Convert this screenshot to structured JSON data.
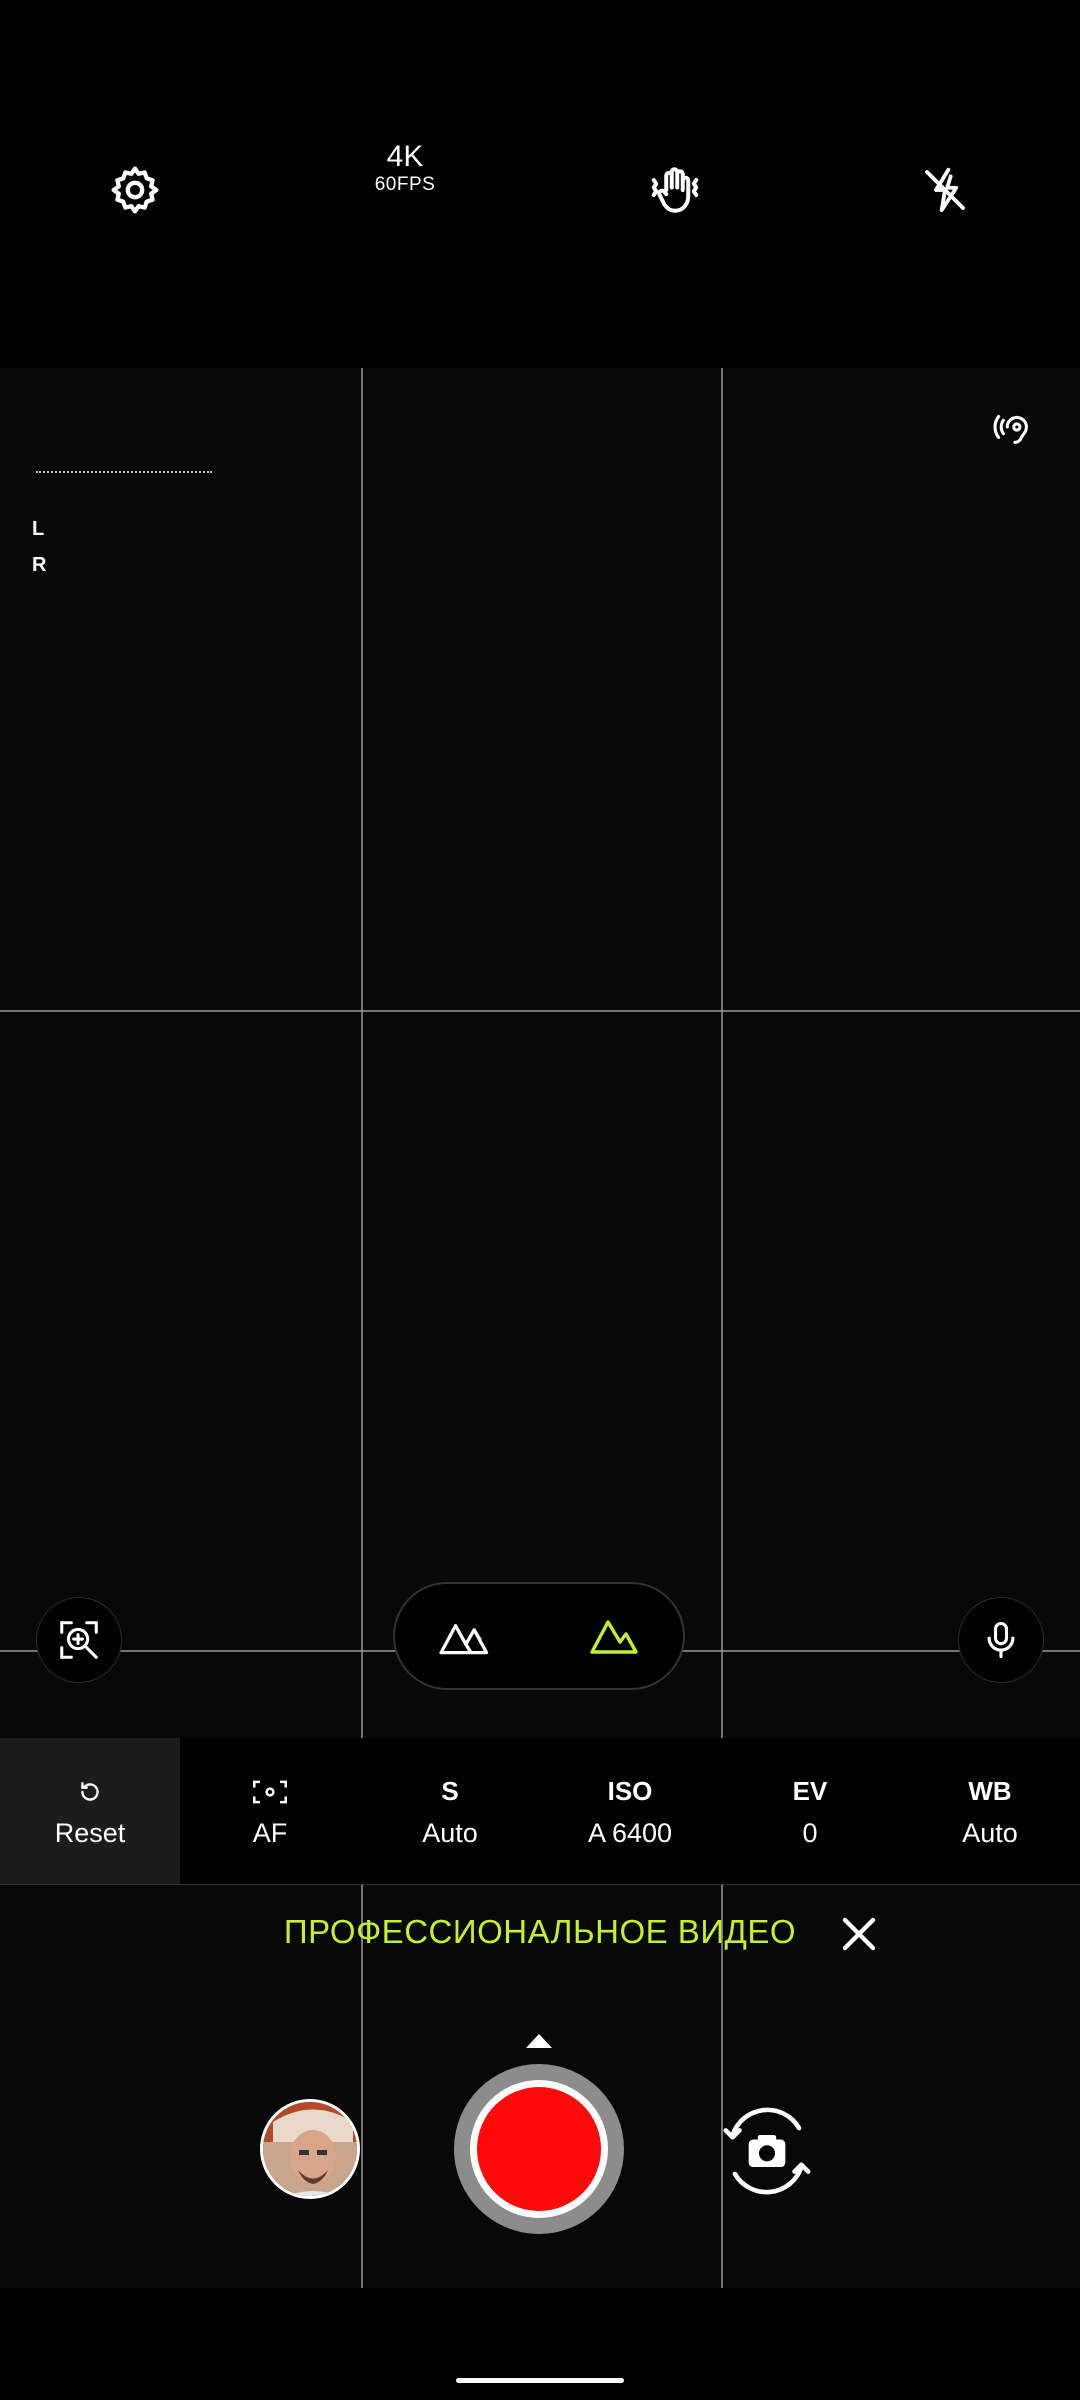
{
  "top_bar": {
    "settings_icon": "gear-icon",
    "resolution": "4K",
    "framerate": "60FPS",
    "stabilization_icon": "hand-shake-icon",
    "flash_icon": "flash-off-icon"
  },
  "viewfinder": {
    "audio_channels": [
      "L",
      "R"
    ],
    "audio_focus_icon": "ear-audio-icon"
  },
  "controls": {
    "zoom_lens_icon": "magnify-zoom-icon",
    "lens_options": [
      "mountains-wide-icon",
      "mountain-standard-icon"
    ],
    "mic_icon": "microphone-icon"
  },
  "pro_params": [
    {
      "title": "↺",
      "value": "Reset",
      "icon": "reset-icon",
      "active": true
    },
    {
      "title": "[·]",
      "value": "AF",
      "icon": "af-icon",
      "active": false
    },
    {
      "title": "S",
      "value": "Auto",
      "active": false
    },
    {
      "title": "ISO",
      "value": "A 6400",
      "active": false
    },
    {
      "title": "EV",
      "value": "0",
      "active": false
    },
    {
      "title": "WB",
      "value": "Auto",
      "active": false
    }
  ],
  "mode": {
    "label": "ПРОФЕССИОНАЛЬНОЕ ВИДЕО",
    "close_icon": "close-icon"
  },
  "bottom": {
    "gallery_icon": "gallery-thumbnail",
    "record_icon": "record-button",
    "flip_icon": "camera-flip-icon"
  },
  "colors": {
    "accent": "#c4f02c",
    "record": "#ff0a0a"
  }
}
